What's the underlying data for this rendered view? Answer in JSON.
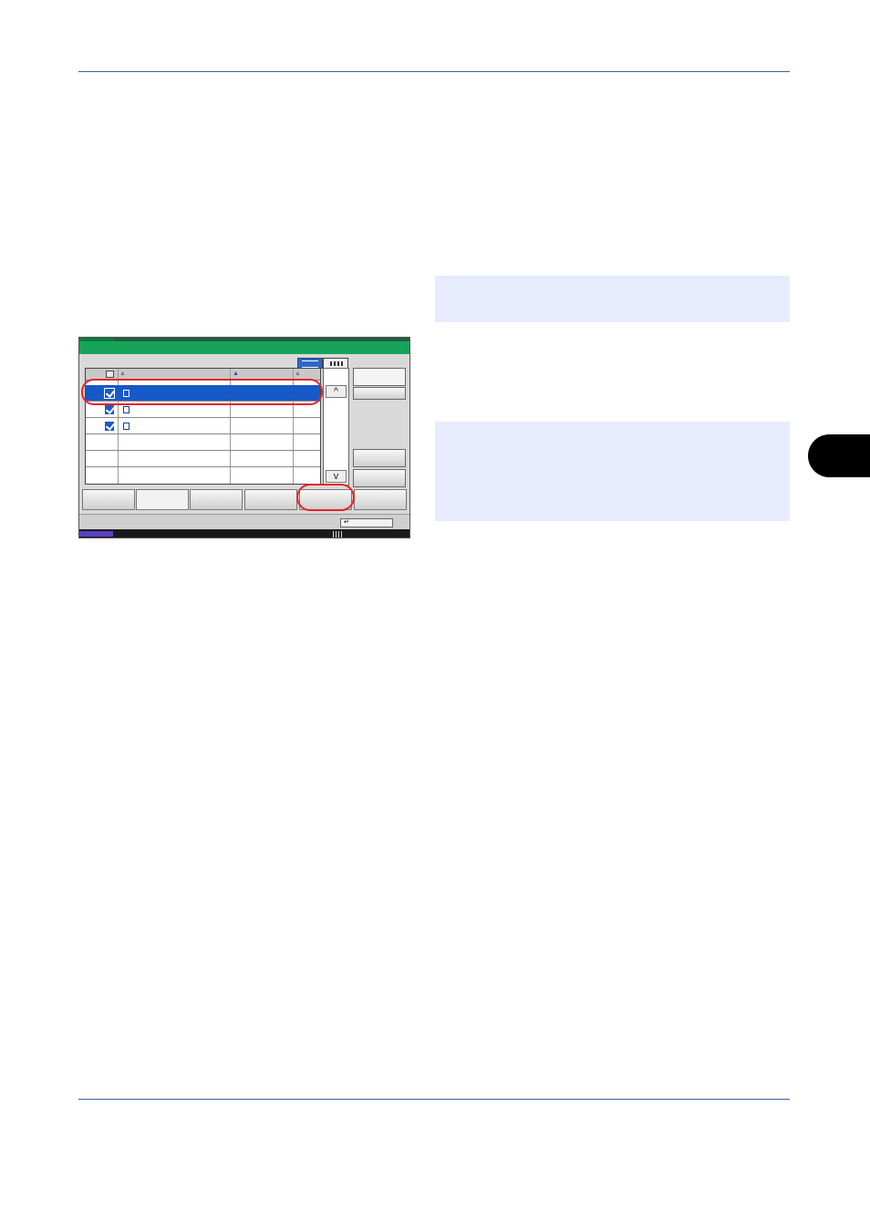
{
  "document": {
    "panel": {
      "rows": [
        {
          "checked": true,
          "selected": true
        },
        {
          "checked": true,
          "selected": false
        },
        {
          "checked": true,
          "selected": false
        },
        {
          "checked": false,
          "selected": false
        },
        {
          "checked": false,
          "selected": false
        },
        {
          "checked": false,
          "selected": false
        }
      ],
      "scroll_up_glyph": "^",
      "scroll_down_glyph": "v",
      "status_button_glyph": "↵",
      "icons": [
        "document-icon",
        "checkbox-icon",
        "list-view-icon",
        "thumbnail-view-icon"
      ]
    },
    "colors": {
      "rule": "#3a5fa8",
      "note_background": "#e6ecfb",
      "highlight": "#e2262b",
      "selection": "#1659c8",
      "header_green": "#17a35a"
    }
  }
}
